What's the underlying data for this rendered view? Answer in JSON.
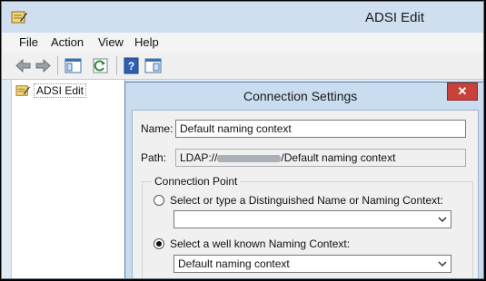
{
  "app": {
    "title": "ADSI Edit"
  },
  "menu": {
    "items": [
      "File",
      "Action",
      "View",
      "Help"
    ]
  },
  "toolbar": {
    "buttons": [
      "back-icon",
      "forward-icon",
      "show-tree-icon",
      "refresh-icon",
      "help-icon",
      "properties-icon"
    ]
  },
  "tree": {
    "root_label": "ADSI Edit"
  },
  "dialog": {
    "title": "Connection Settings",
    "close_glyph": "✕",
    "name_label": "Name:",
    "name_value": "Default naming context",
    "path_label": "Path:",
    "path_prefix": "LDAP://",
    "path_suffix": "/Default naming context",
    "group_label": "Connection Point",
    "option_dn_label": "Select or type a Distinguished Name or Naming Context:",
    "option_dn_value": "",
    "option_known_label": "Select a well known Naming Context:",
    "option_known_value": "Default naming context",
    "selected_option": "well-known"
  },
  "colors": {
    "close_button": "#c8423c",
    "title_bar": "#cfdff0",
    "dialog_frame": "#c9dcf0"
  }
}
